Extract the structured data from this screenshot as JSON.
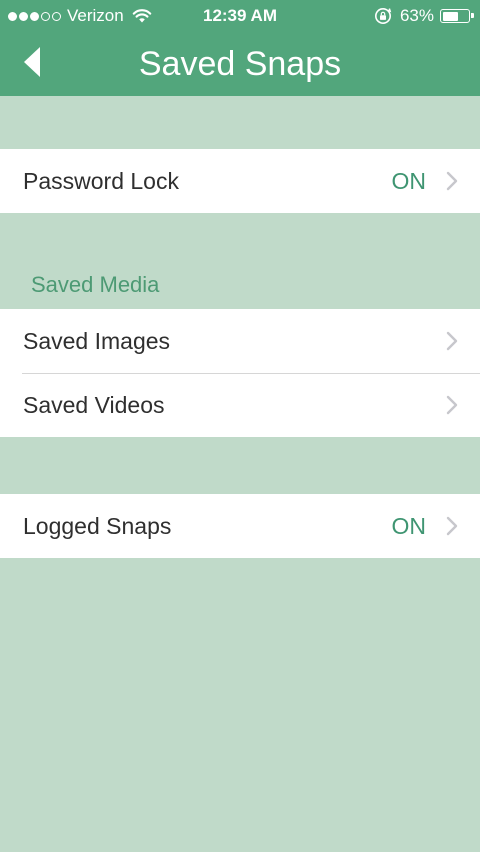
{
  "status_bar": {
    "carrier": "Verizon",
    "signal_bars_filled": 3,
    "signal_bars_total": 5,
    "time": "12:39 AM",
    "battery_percent_label": "63%",
    "battery_level": 0.63,
    "icons": [
      "wifi-icon",
      "rotation-lock-icon",
      "battery-icon"
    ]
  },
  "nav": {
    "title": "Saved Snaps",
    "back_icon": "back-arrow-icon"
  },
  "groups": {
    "password": {
      "label": "Password Lock",
      "value": "ON"
    },
    "saved_media": {
      "header": "Saved Media",
      "images_label": "Saved Images",
      "videos_label": "Saved Videos"
    },
    "logged": {
      "label": "Logged Snaps",
      "value": "ON"
    }
  },
  "colors": {
    "nav_background": "#52a67c",
    "page_background": "#c0dac9",
    "accent_text": "#3f9572",
    "row_background": "#ffffff"
  }
}
